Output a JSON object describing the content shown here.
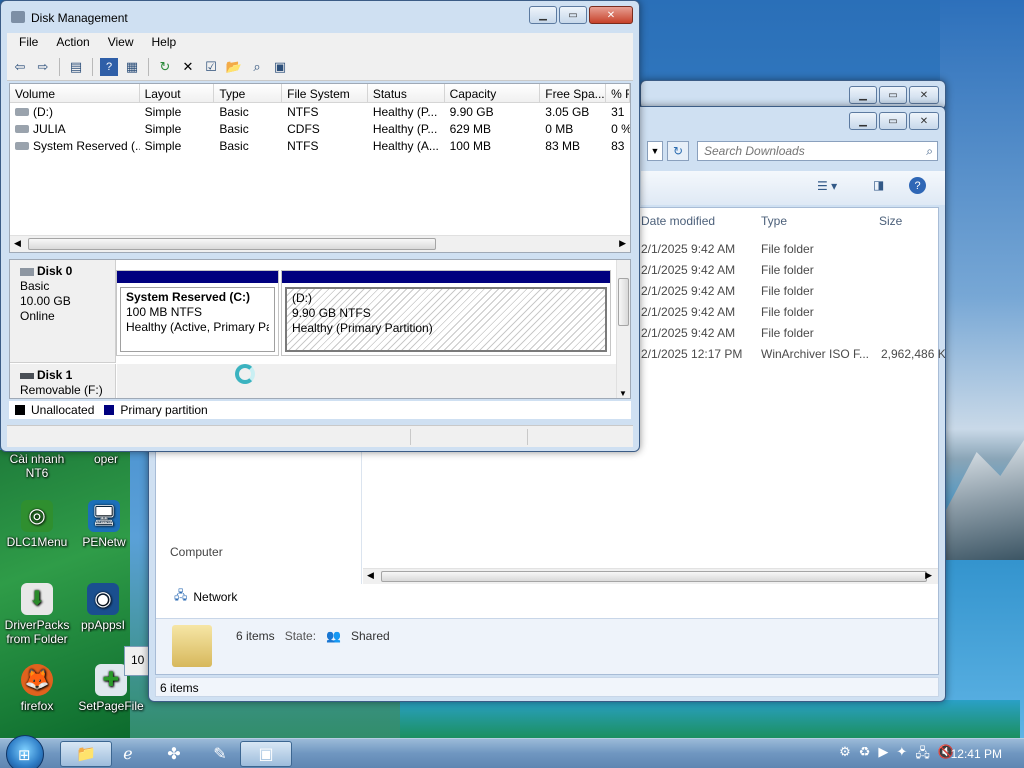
{
  "desktop": {
    "icons": [
      {
        "label": "Cài nhanh NT6",
        "glyph": "⚙"
      },
      {
        "label": "oper",
        "glyph": "●"
      },
      {
        "label": "DLC1Menu",
        "glyph": "◎"
      },
      {
        "label": "PENetw",
        "glyph": "🖥"
      },
      {
        "label": "DriverPacks from Folder",
        "glyph": "⬇"
      },
      {
        "label": "ppAppsI",
        "glyph": "◉"
      },
      {
        "label": "firefox",
        "glyph": "🦊"
      },
      {
        "label": "SetPageFile",
        "glyph": "✚"
      }
    ]
  },
  "explorer": {
    "search_placeholder": "Search Downloads",
    "columns": [
      "Date modified",
      "Type",
      "Size"
    ],
    "rows": [
      {
        "date": "2/1/2025 9:42 AM",
        "type": "File folder",
        "size": ""
      },
      {
        "date": "2/1/2025 9:42 AM",
        "type": "File folder",
        "size": ""
      },
      {
        "date": "2/1/2025 9:42 AM",
        "type": "File folder",
        "size": ""
      },
      {
        "date": "2/1/2025 9:42 AM",
        "type": "File folder",
        "size": ""
      },
      {
        "date": "2/1/2025 9:42 AM",
        "type": "File folder",
        "size": ""
      },
      {
        "date": "2/1/2025 12:17 PM",
        "type": "WinArchiver ISO F...",
        "size": "2,962,486 K"
      }
    ],
    "nav": {
      "computer": "Computer",
      "network": "Network"
    },
    "details": {
      "count": "6 items",
      "state_label": "State:",
      "state_value": "Shared"
    },
    "status": "6 items",
    "side_number": "10"
  },
  "dm": {
    "title": "Disk Management",
    "menu": [
      "File",
      "Action",
      "View",
      "Help"
    ],
    "columns": [
      "Volume",
      "Layout",
      "Type",
      "File System",
      "Status",
      "Capacity",
      "Free Spa...",
      "% F"
    ],
    "volumes": [
      {
        "volume": "(D:)",
        "layout": "Simple",
        "type": "Basic",
        "fs": "NTFS",
        "status": "Healthy (P...",
        "capacity": "9.90 GB",
        "free": "3.05 GB",
        "pct": "31"
      },
      {
        "volume": "JULIA",
        "layout": "Simple",
        "type": "Basic",
        "fs": "CDFS",
        "status": "Healthy (P...",
        "capacity": "629 MB",
        "free": "0 MB",
        "pct": "0 %"
      },
      {
        "volume": "System Reserved (...",
        "layout": "Simple",
        "type": "Basic",
        "fs": "NTFS",
        "status": "Healthy (A...",
        "capacity": "100 MB",
        "free": "83 MB",
        "pct": "83"
      }
    ],
    "disk0": {
      "name": "Disk 0",
      "type": "Basic",
      "size": "10.00 GB",
      "state": "Online"
    },
    "disk0_parts": [
      {
        "name": "System Reserved (C:)",
        "size": "100 MB NTFS",
        "status": "Healthy (Active, Primary Par"
      },
      {
        "name": "(D:)",
        "size": "9.90 GB NTFS",
        "status": "Healthy (Primary Partition)"
      }
    ],
    "disk1": {
      "name": "Disk 1",
      "type": "Removable (F:)"
    },
    "legend": {
      "unallocated": "Unallocated",
      "primary": "Primary partition"
    },
    "colors": {
      "unallocated": "#000000",
      "primary": "#00007f"
    }
  },
  "taskbar": {
    "clock": "12:41 PM"
  }
}
